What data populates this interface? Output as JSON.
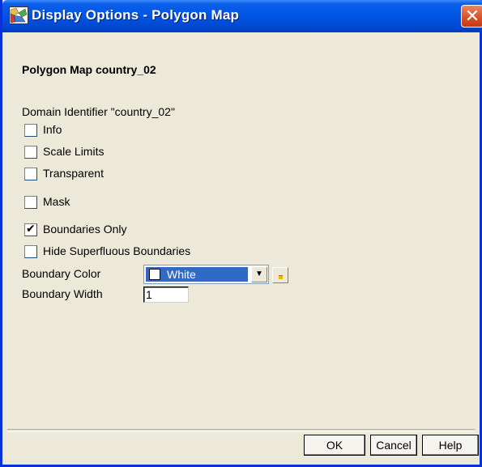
{
  "window": {
    "title": "Display Options - Polygon Map",
    "close_glyph": "✕",
    "icon": "polygon-map-icon"
  },
  "content": {
    "map_title": "Polygon Map  country_02",
    "domain_identifier": "Domain Identifier \"country_02\""
  },
  "options": [
    {
      "label": "Info",
      "checked": false
    },
    {
      "label": "Scale Limits",
      "checked": false
    },
    {
      "label": "Transparent",
      "checked": false
    },
    {
      "label": "Mask",
      "checked": false
    },
    {
      "label": "Boundaries Only",
      "checked": true
    },
    {
      "label": "Hide Superfluous Boundaries",
      "checked": false
    }
  ],
  "boundary_color": {
    "label": "Boundary Color",
    "value": "White",
    "swatch_color": "#ffffff",
    "highlight_color": "#316ac5"
  },
  "boundary_width": {
    "label": "Boundary Width",
    "value": "1"
  },
  "buttons": {
    "ok": "OK",
    "cancel": "Cancel",
    "help": "Help"
  },
  "colors": {
    "titlebar": "#0055e5",
    "window_bg": "#ece9d8",
    "close": "#d9532b"
  }
}
